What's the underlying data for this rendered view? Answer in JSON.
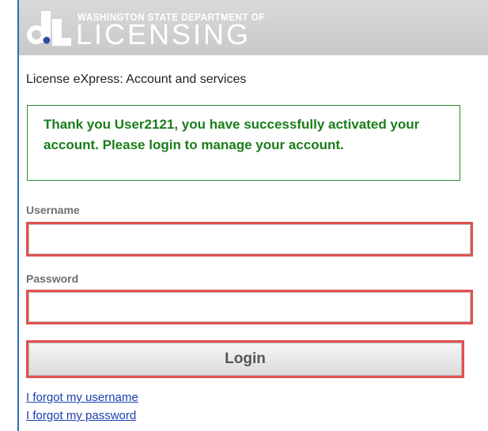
{
  "header": {
    "logo_top": "WASHINGTON STATE DEPARTMENT OF",
    "logo_main": "LICENSING",
    "logo_icon": "dol-logo-icon",
    "colors": {
      "background": "#cfcfcf",
      "text": "#ffffff",
      "accent": "#2b6fb3"
    }
  },
  "page": {
    "subtitle": "License eXpress: Account and services"
  },
  "alert": {
    "message": "Thank you User2121, you have successfully activated your account. Please login to manage your account.",
    "color": "#1a7d1a"
  },
  "form": {
    "username_label": "Username",
    "username_value": "",
    "password_label": "Password",
    "password_value": "",
    "login_label": "Login",
    "highlight_color": "#e0524f"
  },
  "links": {
    "forgot_username": "I forgot my username",
    "forgot_password": "I forgot my password"
  }
}
